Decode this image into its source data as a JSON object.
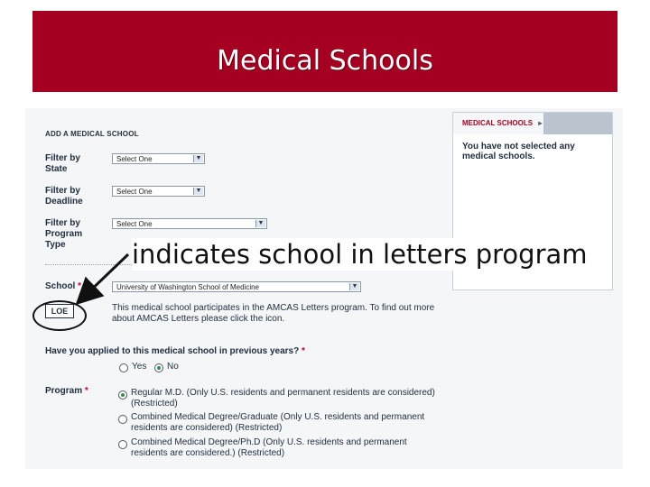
{
  "slide": {
    "title": "Medical Schools",
    "annotation": "indicates school in letters program",
    "accent_color": "#a50021"
  },
  "form": {
    "heading": "ADD A MEDICAL SCHOOL",
    "filters": [
      {
        "label_line1": "Filter by",
        "label_line2": "State",
        "label_line3": "",
        "value": "Select One"
      },
      {
        "label_line1": "Filter by",
        "label_line2": "Deadline",
        "label_line3": "",
        "value": "Select One"
      },
      {
        "label_line1": "Filter by",
        "label_line2": "Program",
        "label_line3": "Type",
        "value": "Select One"
      }
    ],
    "school": {
      "label": "School",
      "required_mark": "*",
      "value": "University of Washington School of Medicine"
    },
    "loe": {
      "badge": "LOE",
      "description": "This medical school participates in the AMCAS Letters program. To find out more about AMCAS Letters please click the icon."
    },
    "applied_before": {
      "question": "Have you applied to this medical school in previous years?",
      "required_mark": "*",
      "options": [
        "Yes",
        "No"
      ],
      "selected": "No"
    },
    "program": {
      "label": "Program",
      "required_mark": "*",
      "options": [
        "Regular M.D. (Only U.S. residents and permanent residents are considered) (Restricted)",
        "Combined Medical Degree/Graduate (Only U.S. residents and permanent residents are considered) (Restricted)",
        "Combined Medical Degree/Ph.D (Only U.S. residents and permanent residents are considered.) (Restricted)"
      ],
      "selected_index": 0
    }
  },
  "sidebar": {
    "tab": "MEDICAL SCHOOLS",
    "tab_arrow": "▸",
    "message": "You have not selected any medical schools."
  },
  "icons": {
    "dropdown": "chevron-down-icon",
    "annotation_arrow": "arrow-icon"
  }
}
